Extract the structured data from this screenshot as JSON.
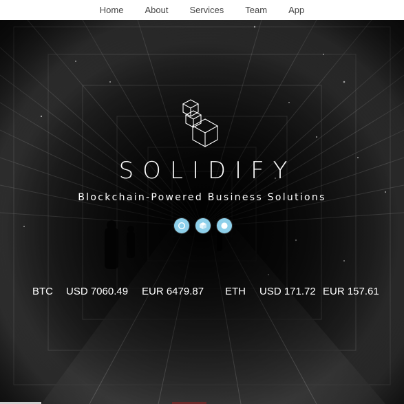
{
  "nav": {
    "items": [
      {
        "label": "Home"
      },
      {
        "label": "About"
      },
      {
        "label": "Services"
      },
      {
        "label": "Team"
      },
      {
        "label": "App"
      }
    ]
  },
  "hero": {
    "logo_icon": "stacked-cubes-icon",
    "title": "SOLIDIFY",
    "tagline": "Blockchain-Powered Business Solutions",
    "dots": [
      {
        "icon": "ring-icon"
      },
      {
        "icon": "cube-icon"
      },
      {
        "icon": "disc-icon"
      }
    ],
    "accent_color": "#8ed0ea"
  },
  "prices": {
    "btc": {
      "symbol": "BTC",
      "usd": "USD 7060.49",
      "eur": "EUR 6479.87"
    },
    "eth": {
      "symbol": "ETH",
      "usd": "USD 171.72",
      "eur": "EUR 157.61"
    }
  }
}
